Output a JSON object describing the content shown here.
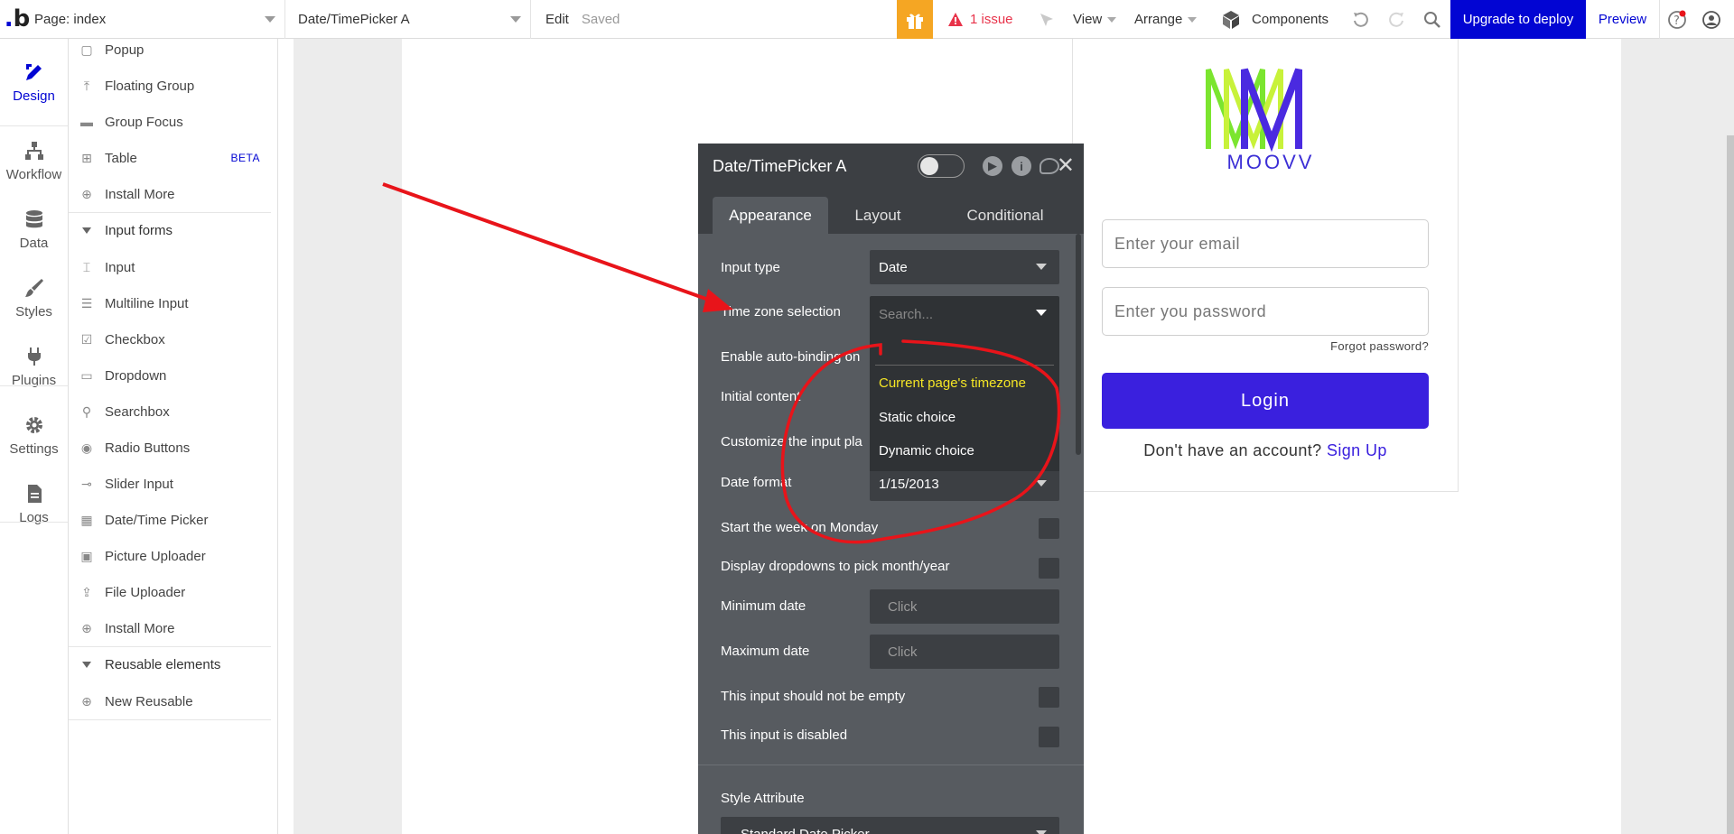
{
  "topbar": {
    "page_label": "Page: index",
    "element_label": "Date/TimePicker A",
    "edit_label": "Edit",
    "saved_label": "Saved",
    "issue_label": "1 issue",
    "view_label": "View",
    "arrange_label": "Arrange",
    "components_label": "Components",
    "upgrade_label": "Upgrade to deploy",
    "preview_label": "Preview"
  },
  "leftnav": {
    "items": [
      {
        "label": "Design",
        "icon": "design-icon"
      },
      {
        "label": "Workflow",
        "icon": "workflow-icon"
      },
      {
        "label": "Data",
        "icon": "database-icon"
      },
      {
        "label": "Styles",
        "icon": "brush-icon"
      },
      {
        "label": "Plugins",
        "icon": "plug-icon"
      },
      {
        "label": "Settings",
        "icon": "gear-icon"
      },
      {
        "label": "Logs",
        "icon": "document-icon"
      }
    ]
  },
  "elements": {
    "popup": "Popup",
    "floating_group": "Floating Group",
    "group_focus": "Group Focus",
    "table": "Table",
    "beta": "BETA",
    "install_more_1": "Install More",
    "input_forms": "Input forms",
    "input": "Input",
    "multiline": "Multiline Input",
    "checkbox": "Checkbox",
    "dropdown": "Dropdown",
    "searchbox": "Searchbox",
    "radio": "Radio Buttons",
    "slider": "Slider Input",
    "datetime": "Date/Time Picker",
    "picture": "Picture Uploader",
    "file": "File Uploader",
    "install_more_2": "Install More",
    "reusable": "Reusable elements",
    "new_reusable": "New Reusable"
  },
  "login": {
    "brand": "MOOVV",
    "email_placeholder": "Enter your email",
    "password_placeholder": "Enter you password",
    "forgot": "Forgot password?",
    "login_button": "Login",
    "no_account": "Don't have an account?",
    "signup": "Sign Up"
  },
  "editor": {
    "title": "Date/TimePicker A",
    "tabs": {
      "appearance": "Appearance",
      "layout": "Layout",
      "conditional": "Conditional"
    },
    "input_type_label": "Input type",
    "input_type_value": "Date",
    "timezone_label": "Time zone selection",
    "timezone_placeholder": "Search...",
    "autobinding_label": "Enable auto-binding on",
    "initial_content_label": "Initial content",
    "customize_label": "Customize the input pla",
    "date_format_label": "Date format",
    "date_format_value": "1/15/2013",
    "start_week_label": "Start the week on Monday",
    "dropdowns_label": "Display dropdowns to pick month/year",
    "min_date_label": "Minimum date",
    "min_date_value": "Click",
    "max_date_label": "Maximum date",
    "max_date_value": "Click",
    "not_empty_label": "This input should not be empty",
    "disabled_label": "This input is disabled",
    "style_label": "Style Attribute",
    "style_value": "Standard Date Picker"
  },
  "dropdown_menu": {
    "options": [
      "Current page's timezone",
      "Static choice",
      "Dynamic choice"
    ],
    "selected_color": "#f5e625"
  },
  "colors": {
    "brand": "#0205d3",
    "login_button": "#3a20de",
    "annotation": "#e8141a",
    "editor_bg": "#575b60"
  }
}
